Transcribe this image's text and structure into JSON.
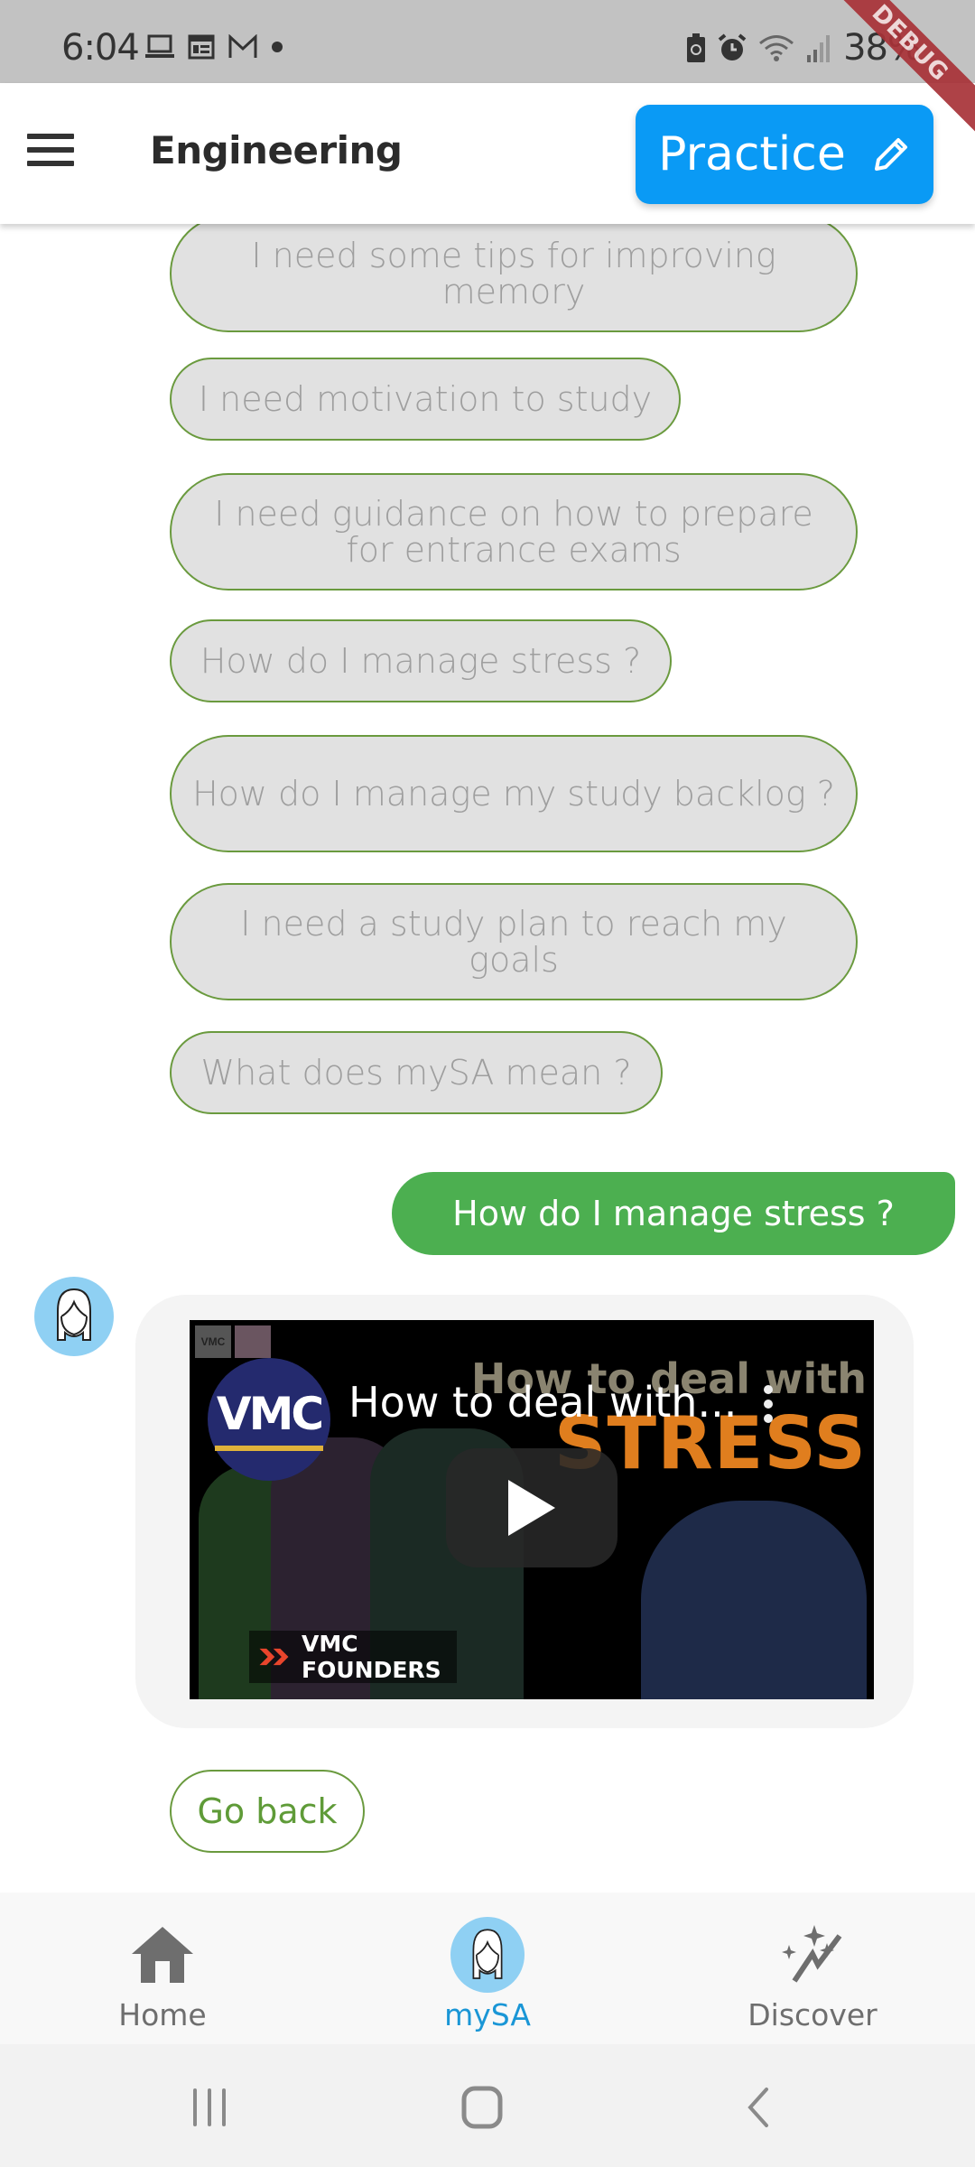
{
  "status_bar": {
    "time": "6:04",
    "left_icons": [
      "laptop-icon",
      "calendar-icon",
      "gmail-icon",
      "dot-icon"
    ],
    "right_icons": [
      "battery-saver-icon",
      "alarm-icon",
      "wifi-icon",
      "signal-icon"
    ],
    "battery": "38%"
  },
  "debug_banner": "DEBUG",
  "app_bar": {
    "title": "Engineering",
    "practice_label": "Practice",
    "practice_icon": "pencil-icon",
    "menu_icon": "hamburger-menu-icon"
  },
  "suggestions": [
    "I need some tips for improving memory",
    "I need motivation to study",
    "I need guidance on how to prepare for entrance exams",
    "How do I manage stress ?",
    "How do I manage my study backlog ?",
    "I need a study plan to reach my goals",
    "What does mySA mean ?"
  ],
  "user_message": "How do I manage stress ?",
  "bot_message": {
    "avatar_icon": "assistant-avatar-icon",
    "video": {
      "channel_logo": "VMC",
      "title": "How to deal with...",
      "thumbnail_heading": "How to deal with",
      "thumbnail_highlight": "STRESS",
      "badge": "VMC FOUNDERS",
      "small_logo": "VMC"
    }
  },
  "go_back_label": "Go back",
  "bottom_nav": {
    "items": [
      {
        "label": "Home",
        "icon": "home-icon",
        "active": false
      },
      {
        "label": "mySA",
        "icon": "assistant-avatar-icon",
        "active": true
      },
      {
        "label": "Discover",
        "icon": "sparkle-trend-icon",
        "active": false
      }
    ]
  },
  "colors": {
    "accent_blue": "#0a9af5",
    "user_bubble": "#4caf50",
    "chip_border": "#6a9a3e",
    "chip_bg": "#e1e1e1",
    "active_nav": "#1a96d6",
    "stress_orange": "#e07e1e"
  }
}
